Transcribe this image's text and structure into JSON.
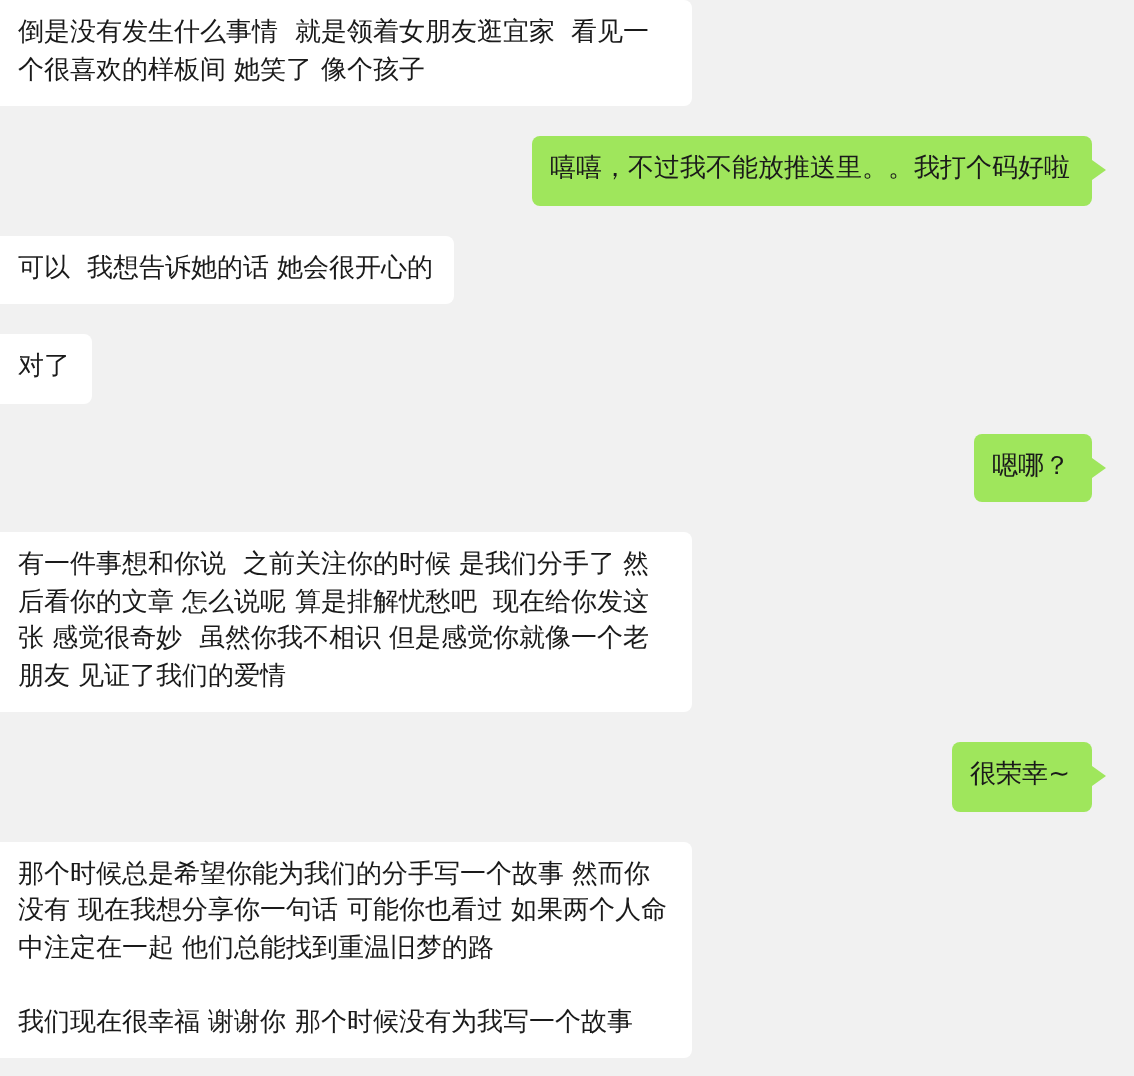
{
  "messages": [
    {
      "kind": "incoming",
      "text": "倒是没有发生什么事情  就是领着女朋友逛宜家  看见一个很喜欢的样板间 她笑了 像个孩子"
    },
    {
      "kind": "outgoing",
      "text": "嘻嘻，不过我不能放推送里。。我打个码好啦"
    },
    {
      "kind": "incoming",
      "text": "可以  我想告诉她的话 她会很开心的"
    },
    {
      "kind": "incoming",
      "text": "对了"
    },
    {
      "kind": "outgoing",
      "text": "嗯哪？"
    },
    {
      "kind": "incoming",
      "text": "有一件事想和你说  之前关注你的时候 是我们分手了 然后看你的文章 怎么说呢 算是排解忧愁吧  现在给你发这张 感觉很奇妙  虽然你我不相识 但是感觉你就像一个老朋友 见证了我们的爱情"
    },
    {
      "kind": "outgoing",
      "text": "很荣幸~"
    },
    {
      "kind": "incoming",
      "text": "那个时候总是希望你能为我们的分手写一个故事 然而你没有 现在我想分享你一句话 可能你也看过 如果两个人命中注定在一起 他们总能找到重温旧梦的路",
      "text_2": "我们现在很幸福 谢谢你 那个时候没有为我写一个故事"
    }
  ]
}
